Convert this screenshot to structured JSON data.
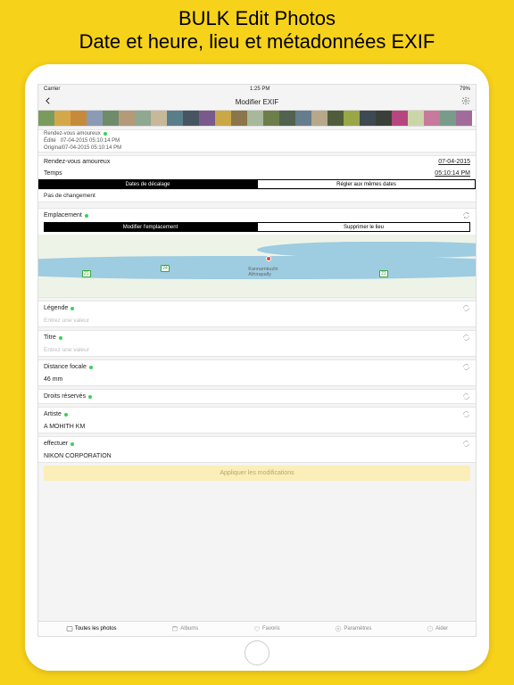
{
  "promo": {
    "line1": "BULK Edit Photos",
    "line2": "Date et heure, lieu et métadonnées EXIF"
  },
  "status": {
    "carrier": "Carrier",
    "time": "1:25 PM",
    "battery": "79%"
  },
  "nav": {
    "title": "Modifier EXIF"
  },
  "dateSection": {
    "header": "Rendez-vous amoureux",
    "edited_label": "Édité",
    "edited_value": "07-04-2015 05:10:14 PM",
    "original_label": "Original",
    "original_value": "07-04-2015 05:10:14 PM"
  },
  "dateRow": {
    "label": "Rendez-vous amoureux",
    "value": "07-04-2015"
  },
  "timeRow": {
    "label": "Temps",
    "value": "05:10:14 PM"
  },
  "seg1": {
    "left": "Dates de décalage",
    "right": "Régler aux mêmes dates"
  },
  "noChange": "Pas de changement",
  "location": {
    "header": "Emplacement",
    "seg_left": "Modifier l'emplacement",
    "seg_right": "Supprimer le lieu"
  },
  "map": {
    "place1": "Kannamkuzhi",
    "place2": "Athirapally",
    "r1": "21",
    "r2": "24",
    "r3": "21"
  },
  "fields": {
    "legende": {
      "label": "Légende",
      "placeholder": "Entrez une valeur"
    },
    "titre": {
      "label": "Titre",
      "placeholder": "Entrez une valeur"
    },
    "focal": {
      "label": "Distance focale",
      "value": "46 mm"
    },
    "droits": {
      "label": "Droits réservés"
    },
    "artiste": {
      "label": "Artiste",
      "value": "A MOHITH KM"
    },
    "effectuer": {
      "label": "effectuer",
      "value": "NIKON CORPORATION"
    }
  },
  "apply": "Appliquer les modifications",
  "tabs": {
    "all": "Toutes les photos",
    "albums": "Albums",
    "fav": "Favoris",
    "params": "Paramètres",
    "help": "Aider"
  },
  "thumbColors": [
    "#7a9b5e",
    "#d4a849",
    "#c68b3a",
    "#8b9bb5",
    "#6e8c6a",
    "#b59a7a",
    "#8fa890",
    "#c7b899",
    "#5a7d8a",
    "#475563",
    "#7a5a8c",
    "#c9a846",
    "#8a764a",
    "#a8b89a",
    "#6e7e4a",
    "#51624f",
    "#667d8d",
    "#b7a88a",
    "#4f5d3c",
    "#99a747",
    "#3e4a52",
    "#3a4039",
    "#b6467f",
    "#cbd6a8",
    "#c77a9c",
    "#789c8a",
    "#a26c9a"
  ]
}
